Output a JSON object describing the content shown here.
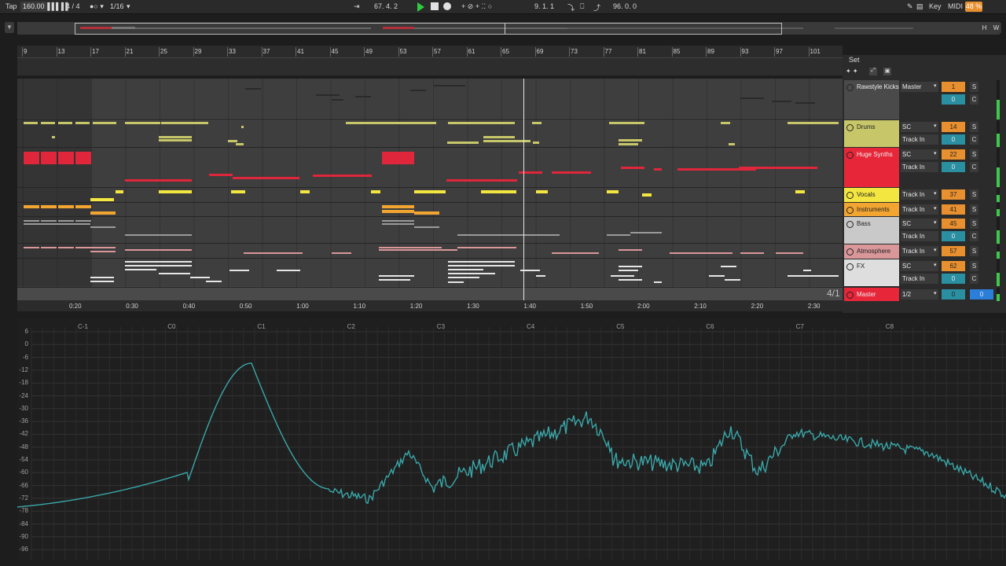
{
  "transport": {
    "tap": "Tap",
    "tempo": "160.00",
    "signature": "4 / 4",
    "quantize": "1/16",
    "position": "67.  4.  2",
    "loop_start": "9.  1.  1",
    "loop_length": "96.  0.  0",
    "key": "Key",
    "midi": "MIDI",
    "cpu": "48 %"
  },
  "overview": {
    "h": "H",
    "w": "W"
  },
  "ruler": {
    "bars": [
      "9",
      "13",
      "17",
      "21",
      "25",
      "29",
      "33",
      "37",
      "41",
      "45",
      "49",
      "53",
      "57",
      "61",
      "65",
      "69",
      "73",
      "77",
      "81",
      "85",
      "89",
      "93",
      "97",
      "101"
    ],
    "times": [
      "0:20",
      "0:30",
      "0:40",
      "0:50",
      "1:00",
      "1:10",
      "1:20",
      "1:30",
      "1:40",
      "1:50",
      "2:00",
      "2:10",
      "2:20",
      "2:30"
    ]
  },
  "set_label": "Set",
  "loop_region_label": "4/1",
  "tracks": [
    {
      "name": "Rawstyle Kicks",
      "color": "#4a4a4a",
      "input": "Master",
      "sub": "",
      "num": "1",
      "vol": "0",
      "s": "S",
      "c": "C"
    },
    {
      "name": "Drums",
      "color": "#c7c76a",
      "input": "SC",
      "sub": "Track In",
      "num": "14",
      "vol": "0",
      "s": "S",
      "c": "C"
    },
    {
      "name": "Huge Synths",
      "color": "#e8263a",
      "input": "SC",
      "sub": "Track In",
      "num": "22",
      "vol": "0",
      "s": "S",
      "c": "C"
    },
    {
      "name": "Vocals",
      "color": "#f4e641",
      "input": "Track In",
      "sub": "",
      "num": "37",
      "vol": "",
      "s": "S",
      "c": ""
    },
    {
      "name": "Instruments",
      "color": "#f2a531",
      "input": "Track In",
      "sub": "",
      "num": "41",
      "vol": "",
      "s": "S",
      "c": ""
    },
    {
      "name": "Bass",
      "color": "#c9c9c9",
      "input": "SC",
      "sub": "Track In",
      "num": "45",
      "vol": "0",
      "s": "S",
      "c": "C"
    },
    {
      "name": "Atmosphere",
      "color": "#d9979a",
      "input": "Track In",
      "sub": "",
      "num": "57",
      "vol": "",
      "s": "S",
      "c": ""
    },
    {
      "name": "FX",
      "color": "#dedede",
      "input": "SC",
      "sub": "Track In",
      "num": "62",
      "vol": "0",
      "s": "S",
      "c": "C"
    },
    {
      "name": "Master",
      "color": "#e8263a",
      "input": "1/2",
      "sub": "",
      "num": "0",
      "vol": "0",
      "s": "",
      "c": ""
    }
  ],
  "spectrum": {
    "y_labels": [
      "6",
      "0",
      "-6",
      "-12",
      "-18",
      "-24",
      "-30",
      "-36",
      "-42",
      "-48",
      "-54",
      "-60",
      "-66",
      "-72",
      "-78",
      "-84",
      "-90",
      "-96"
    ],
    "x_labels": [
      "C-1",
      "C0",
      "C1",
      "C2",
      "C3",
      "C4",
      "C5",
      "C6",
      "C7",
      "C8"
    ]
  },
  "colors": {
    "spectrum_line": "#3aa7a9",
    "playhead": "#e8e8e8",
    "accent": "#e8902f"
  }
}
